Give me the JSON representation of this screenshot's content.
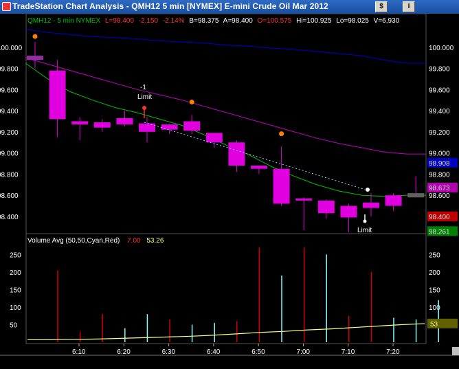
{
  "window": {
    "title": "TradeStation Chart Analysis - QMH12 5 min [NYMEX] E-mini Crude Oil Mar 2012",
    "buttons": [
      "$",
      "I"
    ]
  },
  "price_header": {
    "symbol": "QMH12 - 5 min  NYMEX",
    "last": "L=98.400",
    "change": "-2.150",
    "change_pct": "-2.14%",
    "bid": "B=98.375",
    "ask": "A=98.400",
    "open": "O=100.575",
    "high": "Hi=100.925",
    "low": "Lo=98.025",
    "volume": "V=6,930"
  },
  "volume_header": {
    "label": "Volume Avg (50,50,Cyan,Red)",
    "value1": "7.00",
    "value2": "53.26"
  },
  "colors": {
    "candle": "#e000e0",
    "ma_fast": "#00c000",
    "ma_mid": "#c000c0",
    "ma_slow": "#0000d0",
    "volume_up": "#80ffff",
    "volume_down": "#d00000",
    "volume_avg": "#ffff80",
    "order_marker": "#ff8000"
  },
  "annotations": {
    "sell_limit": "-1\nLimit",
    "sell_limit_qty": "-1",
    "sell_limit_word": "Limit",
    "buy_limit_word": "Limit"
  },
  "price_axis_right_badges": [
    {
      "label": "98.908",
      "color": "#0000c0"
    },
    {
      "label": "98.673",
      "color": "#b000b0"
    },
    {
      "label": "98.400",
      "color": "#c00000"
    },
    {
      "label": "98.261",
      "color": "#008000"
    }
  ],
  "volume_axis_right_badge": "53",
  "chart_data": {
    "type": "candlestick",
    "x_labels": [
      "6:10",
      "6:20",
      "6:30",
      "6:40",
      "6:50",
      "7:00",
      "7:10",
      "7:20"
    ],
    "price_axis": {
      "ylim": [
        98.25,
        100.2
      ],
      "ticks": [
        100.0,
        99.8,
        99.6,
        99.4,
        99.2,
        99.0,
        98.8,
        98.6,
        98.4
      ],
      "tick_labels": [
        "100.000",
        "99.800",
        "99.600",
        "99.400",
        "99.200",
        "99.000",
        "98.800",
        "98.600",
        "98.400"
      ]
    },
    "volume_axis": {
      "ylim": [
        0,
        280
      ],
      "ticks": [
        250,
        200,
        150,
        100,
        50
      ],
      "tick_labels": [
        "250",
        "200",
        "150",
        "100",
        "50"
      ]
    },
    "candles": [
      {
        "o": 99.92,
        "h": 100.05,
        "l": 99.8,
        "c": 99.88
      },
      {
        "o": 99.78,
        "h": 99.88,
        "l": 99.15,
        "c": 99.32
      },
      {
        "o": 99.3,
        "h": 99.34,
        "l": 99.12,
        "c": 99.27
      },
      {
        "o": 99.29,
        "h": 99.32,
        "l": 99.2,
        "c": 99.24
      },
      {
        "o": 99.33,
        "h": 99.4,
        "l": 99.25,
        "c": 99.27
      },
      {
        "o": 99.28,
        "h": 99.34,
        "l": 99.1,
        "c": 99.2
      },
      {
        "o": 99.27,
        "h": 99.28,
        "l": 99.18,
        "c": 99.22
      },
      {
        "o": 99.21,
        "h": 99.36,
        "l": 99.18,
        "c": 99.3
      },
      {
        "o": 99.19,
        "h": 99.19,
        "l": 99.05,
        "c": 99.1
      },
      {
        "o": 99.1,
        "h": 99.12,
        "l": 98.82,
        "c": 98.88
      },
      {
        "o": 98.88,
        "h": 98.88,
        "l": 98.8,
        "c": 98.85
      },
      {
        "o": 98.85,
        "h": 99.06,
        "l": 98.5,
        "c": 98.52
      },
      {
        "o": 98.57,
        "h": 98.58,
        "l": 98.27,
        "c": 98.55
      },
      {
        "o": 98.55,
        "h": 98.56,
        "l": 98.38,
        "c": 98.43
      },
      {
        "o": 98.5,
        "h": 98.52,
        "l": 98.25,
        "c": 98.39
      },
      {
        "o": 98.48,
        "h": 98.62,
        "l": 98.4,
        "c": 98.53
      },
      {
        "o": 98.6,
        "h": 98.62,
        "l": 98.45,
        "c": 98.5
      },
      {
        "o": 98.62,
        "h": 98.78,
        "l": 98.58,
        "c": 98.58
      }
    ],
    "volume_bars": [
      {
        "v": 205,
        "dir": "down"
      },
      {
        "v": 30,
        "dir": "down"
      },
      {
        "v": 80,
        "dir": "down"
      },
      {
        "v": 40,
        "dir": "up"
      },
      {
        "v": 80,
        "dir": "up"
      },
      {
        "v": 65,
        "dir": "down"
      },
      {
        "v": 50,
        "dir": "up"
      },
      {
        "v": 55,
        "dir": "up"
      },
      {
        "v": 60,
        "dir": "down"
      },
      {
        "v": 270,
        "dir": "down"
      },
      {
        "v": 190,
        "dir": "up"
      },
      {
        "v": 270,
        "dir": "down"
      },
      {
        "v": 250,
        "dir": "up"
      },
      {
        "v": 75,
        "dir": "down"
      },
      {
        "v": 200,
        "dir": "down"
      },
      {
        "v": 70,
        "dir": "up"
      },
      {
        "v": 65,
        "dir": "up"
      },
      {
        "v": 120,
        "dir": "up"
      }
    ],
    "volume_avg_line": [
      7,
      7,
      8,
      9,
      11,
      13,
      15,
      17,
      20,
      24,
      28,
      31,
      35,
      38,
      42,
      46,
      50,
      53
    ],
    "ma_fast": [
      99.85,
      99.7,
      99.58,
      99.5,
      99.43,
      99.38,
      99.32,
      99.26,
      99.17,
      99.07,
      98.98,
      98.87,
      98.78,
      98.7,
      98.64,
      98.6,
      98.59,
      98.6
    ],
    "ma_mid": [
      99.9,
      99.84,
      99.78,
      99.72,
      99.66,
      99.6,
      99.55,
      99.5,
      99.44,
      99.38,
      99.32,
      99.26,
      99.2,
      99.14,
      99.09,
      99.05,
      99.01,
      98.99
    ],
    "ma_slow": [
      100.17,
      100.14,
      100.12,
      100.1,
      100.09,
      100.08,
      100.06,
      100.05,
      100.04,
      100.02,
      100.01,
      99.99,
      99.98,
      99.96,
      99.94,
      99.92,
      99.88,
      99.85
    ]
  }
}
